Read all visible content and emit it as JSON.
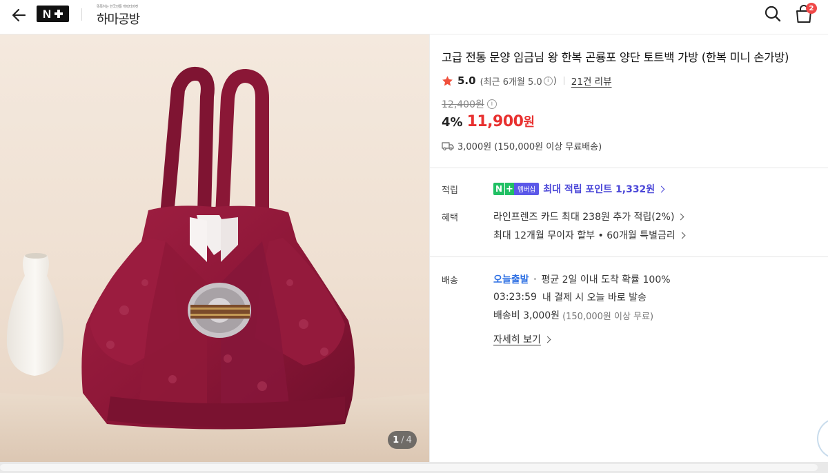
{
  "header": {
    "brand_tagline": "똑똑하는 한국전통 캐릭터마켓",
    "brand_name": "하마공방",
    "logo_text": "N",
    "cart_count": "2",
    "icons": [
      "arrow-left-icon",
      "naver-plus-logo",
      "search-icon",
      "shopping-bag-icon"
    ]
  },
  "gallery": {
    "current": "1",
    "separator": "/",
    "total": "4"
  },
  "product": {
    "title": "고급 전통 문양 임금님 왕 한복 곤룡포 양단 토트백 가방 (한복 미니 손가방)",
    "rating": "5.0",
    "rating_recent_prefix": "(최근 6개월 5.0",
    "rating_recent_suffix": ")",
    "review_count": "21건 리뷰",
    "original_price": "12,400원",
    "discount": "4%",
    "price": "11,900",
    "price_unit": "원",
    "shipping": "3,000원 (150,000원 이상 무료배송)"
  },
  "points": {
    "label": "적립",
    "badge_n": "N",
    "badge_plus": "+",
    "badge_membership": "멤버십",
    "text": "최대 적립 포인트 1,332원"
  },
  "benefits": {
    "label": "혜택",
    "line1": "라인프렌즈 카드 최대 238원 추가 적립(2%)",
    "line2": "최대 12개월 무이자 할부 • 60개월 특별금리"
  },
  "delivery": {
    "label": "배송",
    "today_label": "오늘출발",
    "arrival_text": "평균 2일 이내 도착 확률 100%",
    "countdown": "03:23:59",
    "countdown_text": "내 결제 시 오늘 바로 발송",
    "fee_label": "배송비 3,000원",
    "fee_note": "(150,000원 이상 무료)",
    "detail_link": "자세히 보기"
  },
  "colors": {
    "price_red": "#e8302f",
    "points_purple": "#4b47d8",
    "naver_green": "#21c064",
    "today_blue": "#2d6fe3",
    "bag_burgundy": "#8e1738"
  }
}
